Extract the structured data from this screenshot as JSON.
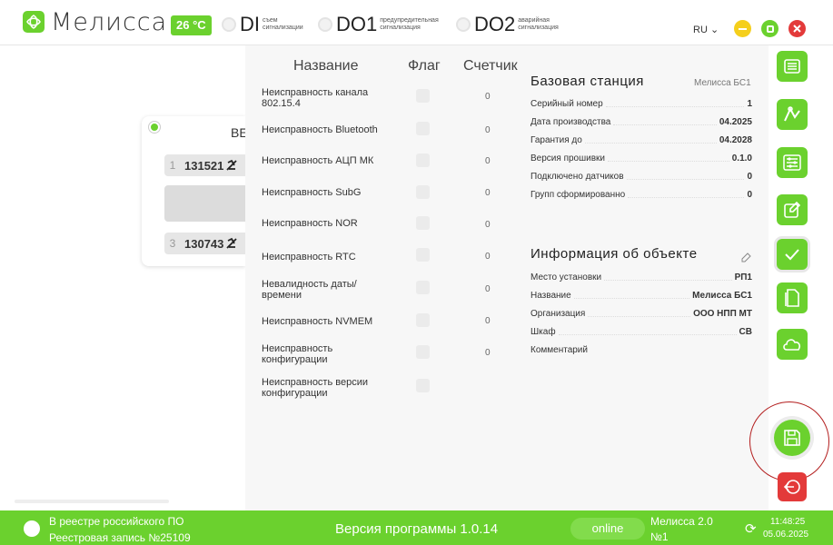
{
  "header": {
    "app_name": "Мелисса",
    "temperature": "26 °C",
    "signals": [
      {
        "code": "DI",
        "caption": "съем сигнализации"
      },
      {
        "code": "DO1",
        "caption": "предупредительная сигнализация"
      },
      {
        "code": "DO2",
        "caption": "аварийная сигнализация"
      }
    ],
    "language": "RU ⌄",
    "colors": {
      "accent": "#6bd12e",
      "minimize": "#f5cf1c",
      "maximize": "#6bd12e",
      "close": "#e33a3a"
    }
  },
  "left": {
    "card_title": "ВЕ",
    "chips": [
      {
        "num": "1",
        "value": "131521",
        "icon": "cable-disconnected-icon"
      },
      {
        "num": "3",
        "value": "130743",
        "icon": "cable-disconnected-icon"
      }
    ]
  },
  "faults": {
    "headers": {
      "name": "Название",
      "flag": "Флаг",
      "count": "Счетчик"
    },
    "rows": [
      {
        "name": "Неисправность канала 802.15.4",
        "count": "0"
      },
      {
        "name": "Неисправность Bluetooth",
        "count": "0"
      },
      {
        "name": "Неисправность АЦП МК",
        "count": "0"
      },
      {
        "name": "Неисправность SubG",
        "count": "0"
      },
      {
        "name": "Неисправность NOR",
        "count": "0"
      },
      {
        "name": "Неисправность RTC",
        "count": "0"
      },
      {
        "name": "Невалидность даты/ времени",
        "count": "0"
      },
      {
        "name": "Неисправность NVMEM",
        "count": "0"
      },
      {
        "name": "Неисправность конфигурации",
        "count": "0"
      },
      {
        "name": "Неисправность версии конфигурации",
        "count": ""
      }
    ]
  },
  "base_station": {
    "title": "Базовая станция",
    "subtitle": "Мелисса БС1",
    "fields": [
      {
        "key": "Серийный номер",
        "value": "1"
      },
      {
        "key": "Дата производства",
        "value": "04.2025"
      },
      {
        "key": "Гарантия до",
        "value": "04.2028"
      },
      {
        "key": "Версия прошивки",
        "value": "0.1.0"
      },
      {
        "key": "Подключено датчиков",
        "value": "0"
      },
      {
        "key": "Групп сформированно",
        "value": "0"
      }
    ]
  },
  "object_info": {
    "title": "Информация об объекте",
    "fields": [
      {
        "key": "Место установки",
        "value": "РП1"
      },
      {
        "key": "Название",
        "value": "Мелисса БС1"
      },
      {
        "key": "Организация",
        "value": "ООО НПП МТ"
      },
      {
        "key": "Шкаф",
        "value": "СВ"
      },
      {
        "key": "Комментарий",
        "value": ""
      }
    ]
  },
  "sidebar": {
    "buttons": [
      "list-icon",
      "chart-icon",
      "sliders-icon",
      "edit-icon",
      "check-icon",
      "document-icon",
      "cloud-icon"
    ],
    "save": "save-icon",
    "exit": "exit-icon"
  },
  "footer": {
    "registry_line1": "В реестре российского ПО",
    "registry_line2": "Реестровая запись №25109",
    "version": "Версия программы  1.0.14",
    "status": "online",
    "device_line1": "Мелисса 2.0",
    "device_line2": "№1",
    "time": "11:48:25",
    "date": "05.06.2025"
  }
}
